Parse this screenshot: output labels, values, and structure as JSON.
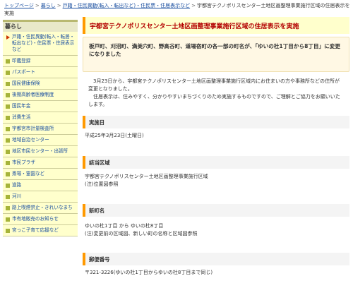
{
  "breadcrumb": {
    "items": [
      "トップページ",
      "暮らし",
      "戸籍・住民異動(転入・転出など)・住民票・住居表示など"
    ],
    "current": "宇都宮テクノポリスセンター土地区画整理事業施行区域の住居表示を実施"
  },
  "sidebar": {
    "heading": "暮らし",
    "items": [
      {
        "label": "戸籍・住民異動(転入・転居・転出など)・住民票・住居表示など",
        "active": true
      },
      {
        "label": "印鑑登録"
      },
      {
        "label": "パスポート"
      },
      {
        "label": "国民健康保険"
      },
      {
        "label": "後期高齢者医療制度"
      },
      {
        "label": "国民年金"
      },
      {
        "label": "消費生活"
      },
      {
        "label": "宇都宮市計量検査所"
      },
      {
        "label": "地域自治センター"
      },
      {
        "label": "地区市民センター・出張所"
      },
      {
        "label": "市民プラザ"
      },
      {
        "label": "斎場・霊園など"
      },
      {
        "label": "道路"
      },
      {
        "label": "河川"
      },
      {
        "label": "路上喫煙禁止・きれいなまち"
      },
      {
        "label": "市有地販売のお知らせ"
      },
      {
        "label": "宮っこ子育て応援など"
      }
    ]
  },
  "main": {
    "title": "宇都宮テクノポリスセンター土地区画整理事業施行区域の住居表示を実施",
    "notice": "板戸町、刈沼町、満美穴町、野高谷町、道場宿町の各一部の町名が、「ゆいの杜1丁目から8丁目」に変更になりました",
    "paragraph1": "3月23日から、宇都宮テクノポリスセンター土地区画整理事業施行区域内にお住まいの方や事務所などの住所が変更となりました。",
    "paragraph2": "住居表示は、住みやすく、分かりやすいまちづくりのため実施するものですので、ご理解とご協力をお願いいたします。",
    "sections": [
      {
        "heading": "実施日",
        "lines": [
          "平成25年3月23日(土曜日)"
        ]
      },
      {
        "heading": "該当区域",
        "lines": [
          "宇都宮テクノポリスセンター土地区画整理事業施行区域",
          "(注)位置図参照"
        ]
      },
      {
        "heading": "新町名",
        "lines": [
          "ゆいの杜1丁目 から ゆいの杜8丁目",
          "(注)変更前の区域図、新しい町の名称と区域図参照"
        ]
      },
      {
        "heading": "郵便番号",
        "lines": [
          "〒321-3226(ゆいの杜1丁目からゆいの杜8丁目まで同じ)"
        ]
      }
    ]
  },
  "colors": {
    "accent": "#ff9900",
    "title_text": "#b30000",
    "link": "#1a4fa0",
    "sidebar_bg": "#ffffcc",
    "bullet": "#a6b43a"
  }
}
